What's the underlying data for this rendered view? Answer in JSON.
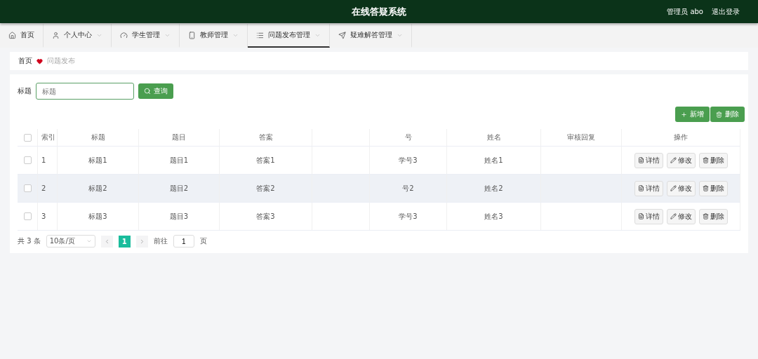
{
  "header": {
    "title": "在线答疑系统",
    "user": "管理员 abo",
    "logout": "退出登录"
  },
  "tabs": [
    {
      "label": "首页",
      "dropdown": false,
      "selected": false
    },
    {
      "label": "个人中心",
      "dropdown": true,
      "selected": false
    },
    {
      "label": "学生管理",
      "dropdown": true,
      "selected": false
    },
    {
      "label": "教师管理",
      "dropdown": true,
      "selected": false
    },
    {
      "label": "问题发布管理",
      "dropdown": true,
      "selected": true
    },
    {
      "label": "疑难解答管理",
      "dropdown": true,
      "selected": false
    }
  ],
  "breadcrumb": {
    "home": "首页",
    "current": "问题发布"
  },
  "search": {
    "label": "标题",
    "placeholder": "标题",
    "button": "查询"
  },
  "actions": [
    "新增",
    "删除"
  ],
  "table": {
    "header_checked": false,
    "columns": [
      "索引",
      "标题",
      "题目",
      "答案",
      "号",
      "姓名",
      "审核回复",
      "操作"
    ],
    "rows": [
      {
        "checked": false,
        "highlighted": false,
        "cells": [
          "1",
          "标题1",
          "题目1",
          "答案1",
          "学号3",
          "姓名1"
        ],
        "buttons": [
          "详情",
          "修改",
          "删除"
        ]
      },
      {
        "checked": false,
        "highlighted": true,
        "cells": [
          "2",
          "标题2",
          "题目2",
          "答案2",
          "号2",
          "姓名2"
        ],
        "buttons": [
          "详情",
          "修改",
          "删除"
        ]
      },
      {
        "checked": false,
        "highlighted": false,
        "cells": [
          "3",
          "标题3",
          "题目3",
          "答案3",
          "学号3",
          "姓名3"
        ],
        "buttons": [
          "详情",
          "修改",
          "删除"
        ]
      }
    ]
  },
  "pagination": {
    "total": "共 3 条",
    "page_size": "10条/页",
    "pages": [
      {
        "label": "1",
        "selected": true
      }
    ],
    "goto": "前往",
    "goto_value": "1",
    "page_unit": "页"
  }
}
